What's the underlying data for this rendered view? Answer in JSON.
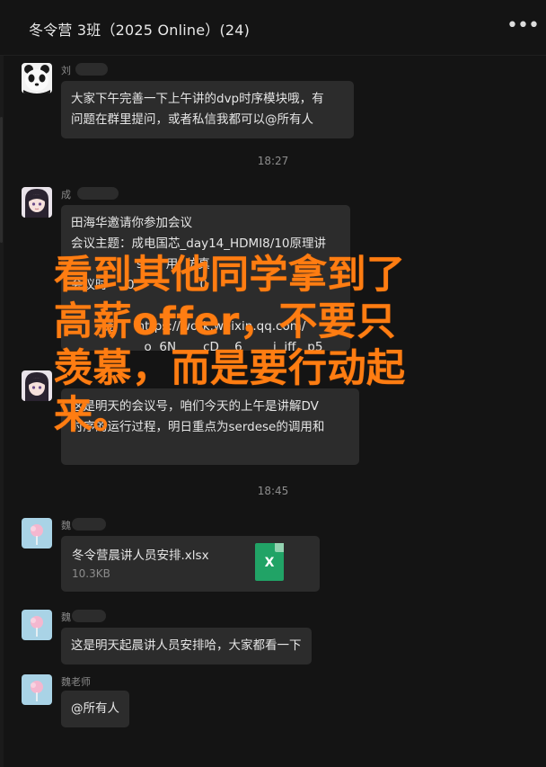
{
  "header": {
    "title": "冬令营 3班（2025 Online）(24)",
    "more_label": "•••"
  },
  "messages": [
    {
      "sender": "刘",
      "text": "大家下午完善一下上午讲的dvp时序模块哦，有\n问题在群里提问，或者私信我都可以@所有人"
    },
    {
      "time": "18:27"
    },
    {
      "sender": "成",
      "text": "田海华邀请你参加会议\n会议主题：成电国芯_day14_HDMI8/10原理讲\n                 s      用  仿真\n会议时     0                 0\n\n        链      https://work.weixin.qq.com/\n                   o  6N       cD    6        j  jff   p5"
    },
    {
      "sender": "",
      "text": "这是明天的会议号，咱们今天的上午是讲解DV\n时序的运行过程，明日重点为serdese的调用和"
    },
    {
      "time": "18:45"
    },
    {
      "sender": "魏",
      "file": {
        "name": "冬令营晨讲人员安排.xlsx",
        "size": "10.3KB",
        "icon_letter": "X"
      }
    },
    {
      "sender": "魏",
      "text": "这是明天起晨讲人员安排哈，大家都看一下"
    },
    {
      "sender": "魏老师",
      "text": "@所有人"
    }
  ],
  "overlay_text": "看到其他同学拿到了\n高薪offer，不要只\n羡慕，而是要行动起\n来。",
  "colors": {
    "background": "#141414",
    "bubble": "#2c2c2c",
    "overlay": "#ff7d12",
    "excel": "#21a366"
  }
}
